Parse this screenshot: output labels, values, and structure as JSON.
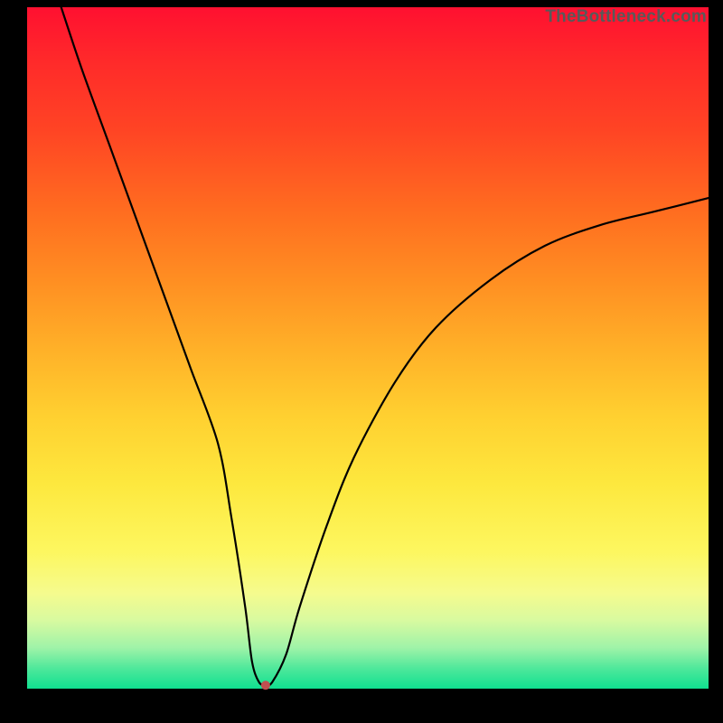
{
  "watermark": "TheBottleneck.com",
  "chart_data": {
    "type": "line",
    "title": "",
    "xlabel": "",
    "ylabel": "",
    "xlim": [
      0,
      100
    ],
    "ylim": [
      0,
      100
    ],
    "grid": false,
    "series": [
      {
        "name": "bottleneck-curve",
        "x": [
          5,
          8,
          12,
          16,
          20,
          24,
          28,
          30,
          32,
          33,
          34,
          35,
          36,
          38,
          40,
          44,
          48,
          54,
          60,
          68,
          76,
          84,
          92,
          100
        ],
        "values": [
          100,
          91,
          80,
          69,
          58,
          47,
          36,
          25,
          12,
          4,
          1,
          0.5,
          1,
          5,
          12,
          24,
          34,
          45,
          53,
          60,
          65,
          68,
          70,
          72
        ]
      }
    ],
    "marker": {
      "x": 35,
      "y": 0.5,
      "color": "#c05050",
      "radius": 5
    },
    "background_gradient": [
      {
        "stop": 0,
        "color": "#ff1030"
      },
      {
        "stop": 0.5,
        "color": "#ffd030"
      },
      {
        "stop": 0.85,
        "color": "#fdf760"
      },
      {
        "stop": 1,
        "color": "#10e090"
      }
    ]
  }
}
